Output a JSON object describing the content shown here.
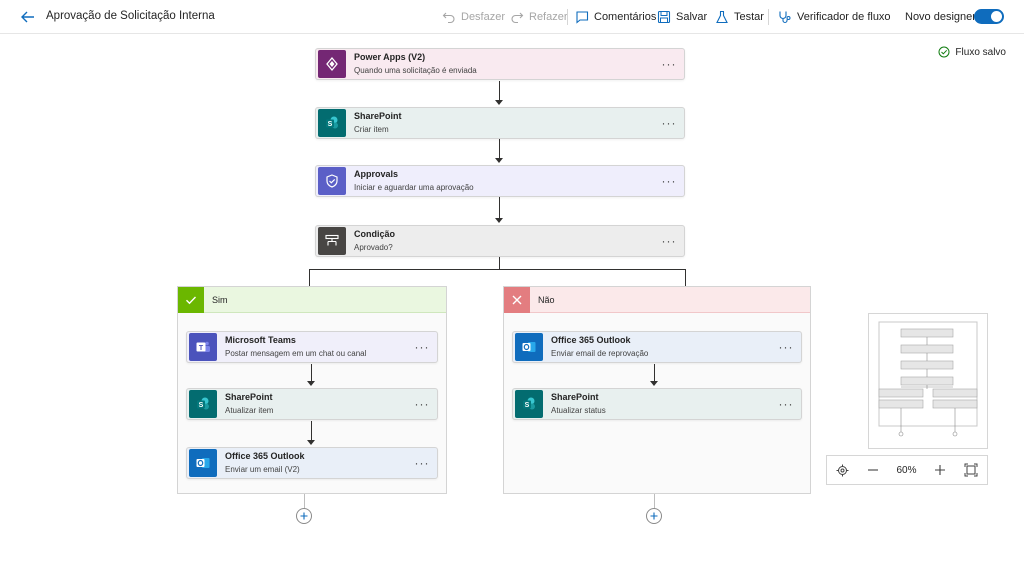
{
  "header": {
    "title": "Aprovação de Solicitação Interna",
    "undo": "Desfazer",
    "redo": "Refazer",
    "comments": "Comentários",
    "save": "Salvar",
    "test": "Testar",
    "flow_checker": "Verificador de fluxo",
    "new_designer": "Novo designer",
    "new_designer_on": true
  },
  "status": "Fluxo salvo",
  "steps": [
    {
      "name": "Power Apps (V2)",
      "sub": "Quando uma solicitação é enviada",
      "icon": "power-apps-icon",
      "color": "#742774"
    },
    {
      "name": "SharePoint",
      "sub": "Criar item",
      "icon": "sharepoint-icon",
      "color": "#036c70"
    },
    {
      "name": "Approvals",
      "sub": "Iniciar e aguardar uma aprovação",
      "icon": "approvals-icon",
      "color": "#5b5fc7"
    },
    {
      "name": "Condição",
      "sub": "Aprovado?",
      "icon": "condition-icon",
      "color": "#484644"
    }
  ],
  "branches": {
    "yes": {
      "label": "Sim",
      "color": "#6bb700",
      "steps": [
        {
          "name": "Microsoft Teams",
          "sub": "Postar mensagem em um chat ou canal",
          "icon": "teams-icon",
          "color": "#4b53bc"
        },
        {
          "name": "SharePoint",
          "sub": "Atualizar item",
          "icon": "sharepoint-icon",
          "color": "#036c70"
        },
        {
          "name": "Office 365 Outlook",
          "sub": "Enviar um email (V2)",
          "icon": "outlook-icon",
          "color": "#0f6cbd"
        }
      ]
    },
    "no": {
      "label": "Não",
      "color": "#e37d80",
      "steps": [
        {
          "name": "Office 365 Outlook",
          "sub": "Enviar email de reprovação",
          "icon": "outlook-icon",
          "color": "#0f6cbd"
        },
        {
          "name": "SharePoint",
          "sub": "Atualizar status",
          "icon": "sharepoint-icon",
          "color": "#036c70"
        }
      ]
    }
  },
  "more_label": "···",
  "zoom": "60%"
}
